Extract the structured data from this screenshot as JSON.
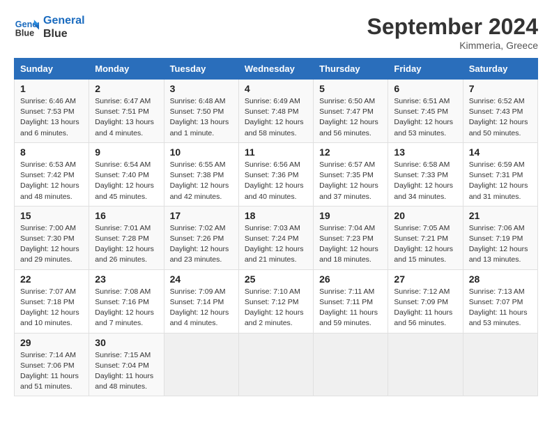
{
  "header": {
    "logo_line1": "General",
    "logo_line2": "Blue",
    "month": "September 2024",
    "location": "Kimmeria, Greece"
  },
  "weekdays": [
    "Sunday",
    "Monday",
    "Tuesday",
    "Wednesday",
    "Thursday",
    "Friday",
    "Saturday"
  ],
  "weeks": [
    [
      {
        "day": "1",
        "info": "Sunrise: 6:46 AM\nSunset: 7:53 PM\nDaylight: 13 hours\nand 6 minutes."
      },
      {
        "day": "2",
        "info": "Sunrise: 6:47 AM\nSunset: 7:51 PM\nDaylight: 13 hours\nand 4 minutes."
      },
      {
        "day": "3",
        "info": "Sunrise: 6:48 AM\nSunset: 7:50 PM\nDaylight: 13 hours\nand 1 minute."
      },
      {
        "day": "4",
        "info": "Sunrise: 6:49 AM\nSunset: 7:48 PM\nDaylight: 12 hours\nand 58 minutes."
      },
      {
        "day": "5",
        "info": "Sunrise: 6:50 AM\nSunset: 7:47 PM\nDaylight: 12 hours\nand 56 minutes."
      },
      {
        "day": "6",
        "info": "Sunrise: 6:51 AM\nSunset: 7:45 PM\nDaylight: 12 hours\nand 53 minutes."
      },
      {
        "day": "7",
        "info": "Sunrise: 6:52 AM\nSunset: 7:43 PM\nDaylight: 12 hours\nand 50 minutes."
      }
    ],
    [
      {
        "day": "8",
        "info": "Sunrise: 6:53 AM\nSunset: 7:42 PM\nDaylight: 12 hours\nand 48 minutes."
      },
      {
        "day": "9",
        "info": "Sunrise: 6:54 AM\nSunset: 7:40 PM\nDaylight: 12 hours\nand 45 minutes."
      },
      {
        "day": "10",
        "info": "Sunrise: 6:55 AM\nSunset: 7:38 PM\nDaylight: 12 hours\nand 42 minutes."
      },
      {
        "day": "11",
        "info": "Sunrise: 6:56 AM\nSunset: 7:36 PM\nDaylight: 12 hours\nand 40 minutes."
      },
      {
        "day": "12",
        "info": "Sunrise: 6:57 AM\nSunset: 7:35 PM\nDaylight: 12 hours\nand 37 minutes."
      },
      {
        "day": "13",
        "info": "Sunrise: 6:58 AM\nSunset: 7:33 PM\nDaylight: 12 hours\nand 34 minutes."
      },
      {
        "day": "14",
        "info": "Sunrise: 6:59 AM\nSunset: 7:31 PM\nDaylight: 12 hours\nand 31 minutes."
      }
    ],
    [
      {
        "day": "15",
        "info": "Sunrise: 7:00 AM\nSunset: 7:30 PM\nDaylight: 12 hours\nand 29 minutes."
      },
      {
        "day": "16",
        "info": "Sunrise: 7:01 AM\nSunset: 7:28 PM\nDaylight: 12 hours\nand 26 minutes."
      },
      {
        "day": "17",
        "info": "Sunrise: 7:02 AM\nSunset: 7:26 PM\nDaylight: 12 hours\nand 23 minutes."
      },
      {
        "day": "18",
        "info": "Sunrise: 7:03 AM\nSunset: 7:24 PM\nDaylight: 12 hours\nand 21 minutes."
      },
      {
        "day": "19",
        "info": "Sunrise: 7:04 AM\nSunset: 7:23 PM\nDaylight: 12 hours\nand 18 minutes."
      },
      {
        "day": "20",
        "info": "Sunrise: 7:05 AM\nSunset: 7:21 PM\nDaylight: 12 hours\nand 15 minutes."
      },
      {
        "day": "21",
        "info": "Sunrise: 7:06 AM\nSunset: 7:19 PM\nDaylight: 12 hours\nand 13 minutes."
      }
    ],
    [
      {
        "day": "22",
        "info": "Sunrise: 7:07 AM\nSunset: 7:18 PM\nDaylight: 12 hours\nand 10 minutes."
      },
      {
        "day": "23",
        "info": "Sunrise: 7:08 AM\nSunset: 7:16 PM\nDaylight: 12 hours\nand 7 minutes."
      },
      {
        "day": "24",
        "info": "Sunrise: 7:09 AM\nSunset: 7:14 PM\nDaylight: 12 hours\nand 4 minutes."
      },
      {
        "day": "25",
        "info": "Sunrise: 7:10 AM\nSunset: 7:12 PM\nDaylight: 12 hours\nand 2 minutes."
      },
      {
        "day": "26",
        "info": "Sunrise: 7:11 AM\nSunset: 7:11 PM\nDaylight: 11 hours\nand 59 minutes."
      },
      {
        "day": "27",
        "info": "Sunrise: 7:12 AM\nSunset: 7:09 PM\nDaylight: 11 hours\nand 56 minutes."
      },
      {
        "day": "28",
        "info": "Sunrise: 7:13 AM\nSunset: 7:07 PM\nDaylight: 11 hours\nand 53 minutes."
      }
    ],
    [
      {
        "day": "29",
        "info": "Sunrise: 7:14 AM\nSunset: 7:06 PM\nDaylight: 11 hours\nand 51 minutes."
      },
      {
        "day": "30",
        "info": "Sunrise: 7:15 AM\nSunset: 7:04 PM\nDaylight: 11 hours\nand 48 minutes."
      },
      {
        "day": "",
        "info": ""
      },
      {
        "day": "",
        "info": ""
      },
      {
        "day": "",
        "info": ""
      },
      {
        "day": "",
        "info": ""
      },
      {
        "day": "",
        "info": ""
      }
    ]
  ]
}
